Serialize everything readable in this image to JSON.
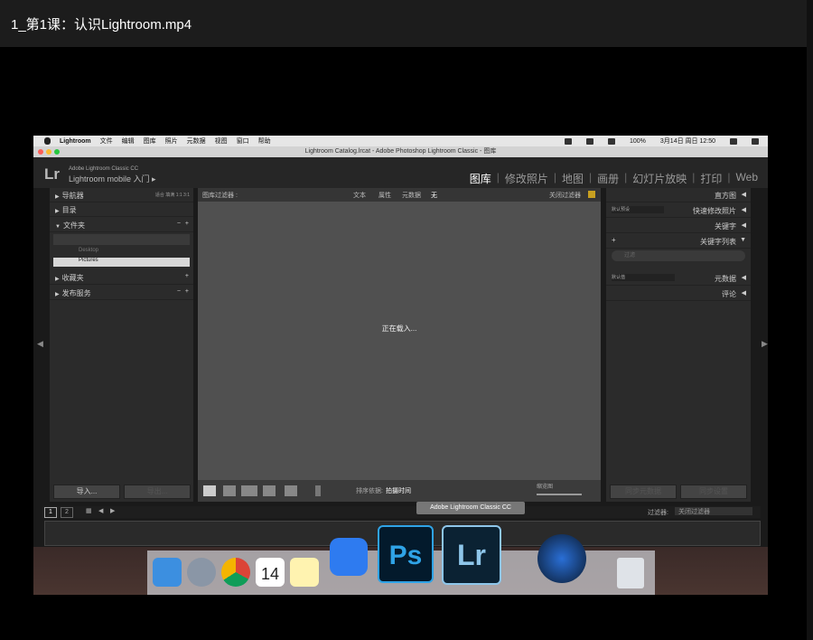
{
  "player": {
    "title": "1_第1课：认识Lightroom.mp4"
  },
  "mac_menubar": {
    "app": "Lightroom",
    "items": [
      "文件",
      "编辑",
      "图库",
      "照片",
      "元数据",
      "视图",
      "窗口",
      "帮助"
    ],
    "status": {
      "battery": "100%",
      "datetime": "3月14日 周日 12:50"
    }
  },
  "window": {
    "title": "Lightroom Catalog.lrcat - Adobe Photoshop Lightroom Classic - 图库"
  },
  "lr_header": {
    "logo": "Lr",
    "line1": "Adobe Lightroom Classic CC",
    "line2": "Lightroom mobile 入门 ▸",
    "modules": [
      "图库",
      "修改照片",
      "地图",
      "画册",
      "幻灯片放映",
      "打印",
      "Web"
    ],
    "active_module": "图库"
  },
  "left_panel": {
    "navigator": "导航器",
    "nav_options": [
      "适合",
      "填满",
      "1:1",
      "3:1"
    ],
    "catalog": "目录",
    "folders": "文件夹",
    "folder_items": [
      "Desktop",
      "Pictures"
    ],
    "collections": "收藏夹",
    "publish": "发布服务",
    "import_btn": "导入...",
    "export_btn": "导出..."
  },
  "filter_bar": {
    "label": "图库过滤器 :",
    "options": [
      "文本",
      "属性",
      "元数据",
      "无"
    ],
    "right": "关闭过滤器"
  },
  "center": {
    "loading": "正在载入..."
  },
  "toolbar": {
    "sort_label": "排序依据:",
    "sort_value": "拍摄时间",
    "thumb_label": "缩览图"
  },
  "right_panel": {
    "histogram": "直方图",
    "quick_develop": "快速修改照片",
    "preset": "默认预设",
    "keywording": "关键字",
    "keyword_list": "关键字列表",
    "keyword_search": "过滤",
    "metadata": "元数据",
    "metadata_preset": "默认值",
    "comments": "评论",
    "sync_meta_btn": "同步元数据",
    "sync_settings_btn": "同步设置"
  },
  "filmstrip": {
    "pages": [
      "1",
      "2"
    ],
    "filter_label": "过滤器:",
    "filter_value": "关闭过滤器"
  },
  "dock": {
    "tooltip": "Adobe Lightroom Classic CC",
    "calendar_day": "14",
    "ps_label": "Ps",
    "lr_label": "Lr"
  }
}
